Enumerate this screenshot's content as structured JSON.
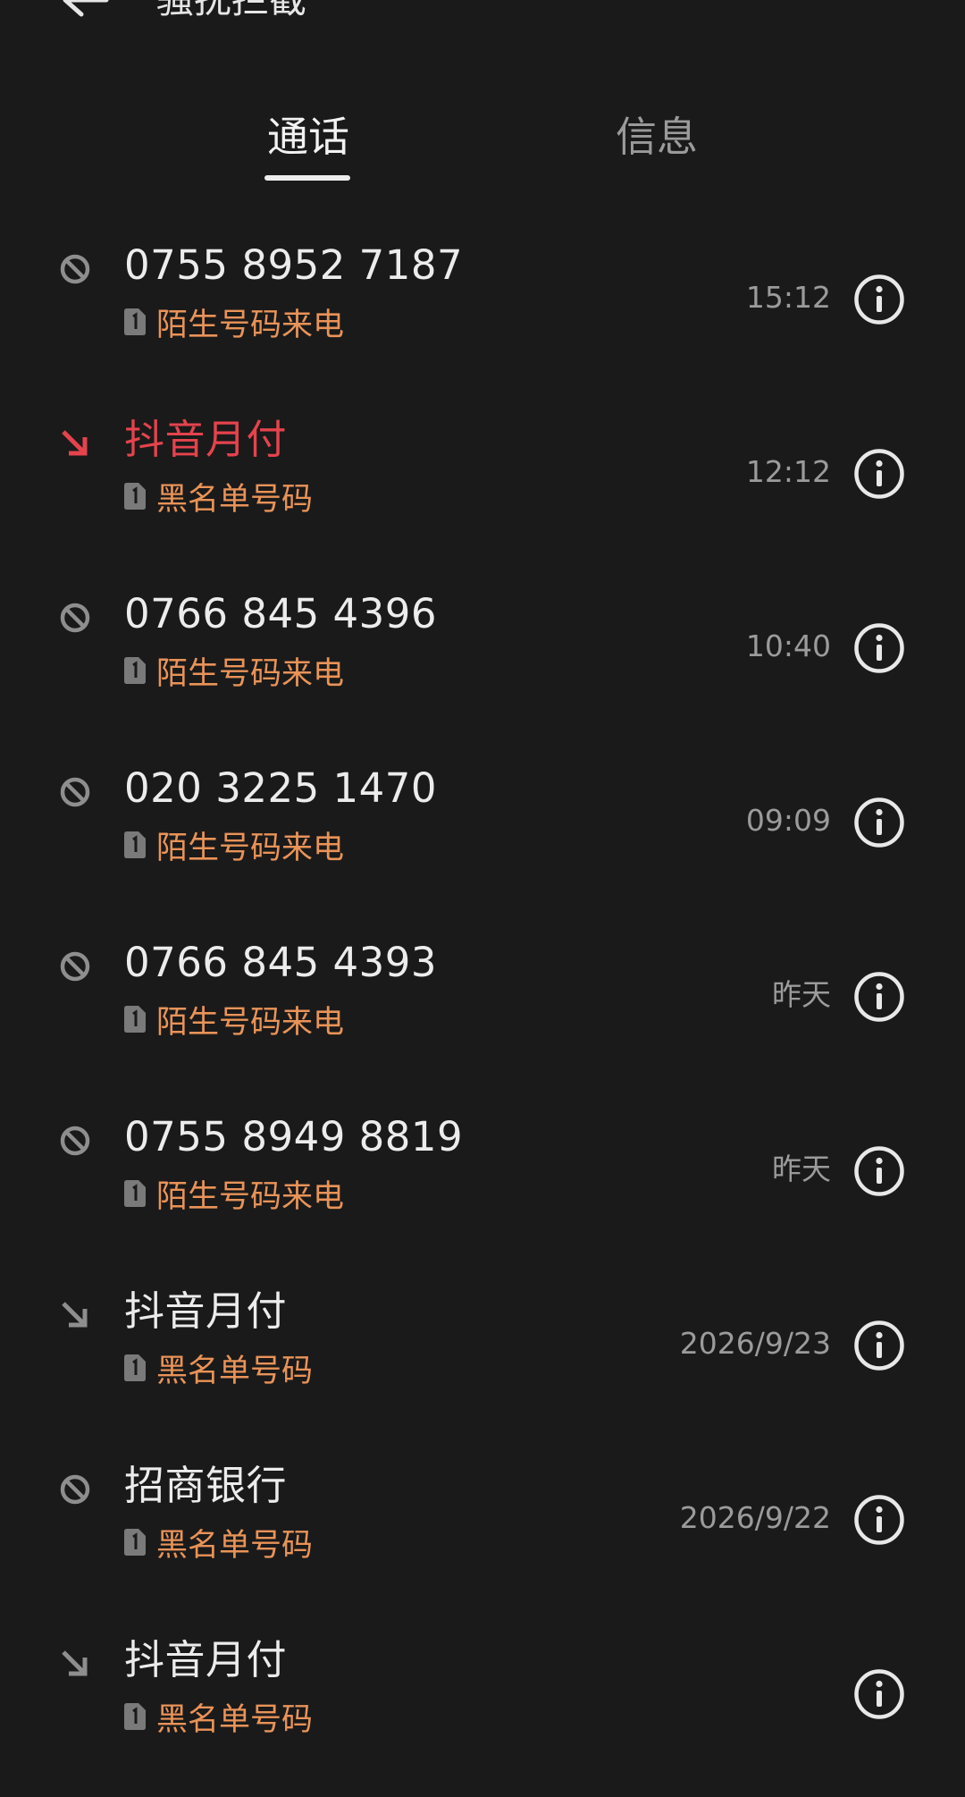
{
  "header": {
    "title": "骚扰拦截",
    "back_icon": "back-arrow-icon",
    "more_icon": "more-vertical-icon"
  },
  "tabs": [
    {
      "label": "通话",
      "active": true
    },
    {
      "label": "信息",
      "active": false
    }
  ],
  "colors": {
    "background": "#1a1a1a",
    "primary_text": "#ececec",
    "secondary_text": "#9b9b9b",
    "tag_orange": "#e99358",
    "missed_red": "#e5434d"
  },
  "calls": [
    {
      "name": "0755 8952 7187",
      "tag": "陌生号码来电",
      "time": "15:12",
      "icon": "blocked-icon",
      "highlight": false
    },
    {
      "name": "抖音月付",
      "tag": "黑名单号码",
      "time": "12:12",
      "icon": "incoming-call-icon",
      "highlight": true
    },
    {
      "name": "0766 845 4396",
      "tag": "陌生号码来电",
      "time": "10:40",
      "icon": "blocked-icon",
      "highlight": false
    },
    {
      "name": "020 3225 1470",
      "tag": "陌生号码来电",
      "time": "09:09",
      "icon": "blocked-icon",
      "highlight": false
    },
    {
      "name": "0766 845 4393",
      "tag": "陌生号码来电",
      "time": "昨天",
      "icon": "blocked-icon",
      "highlight": false
    },
    {
      "name": "0755 8949 8819",
      "tag": "陌生号码来电",
      "time": "昨天",
      "icon": "blocked-icon",
      "highlight": false
    },
    {
      "name": "抖音月付",
      "tag": "黑名单号码",
      "time": "2026/9/23",
      "icon": "incoming-call-icon",
      "highlight": false
    },
    {
      "name": "招商银行",
      "tag": "黑名单号码",
      "time": "2026/9/22",
      "icon": "blocked-icon",
      "highlight": false
    },
    {
      "name": "抖音月付",
      "tag": "黑名单号码",
      "time": "",
      "icon": "incoming-call-icon",
      "highlight": false
    }
  ]
}
